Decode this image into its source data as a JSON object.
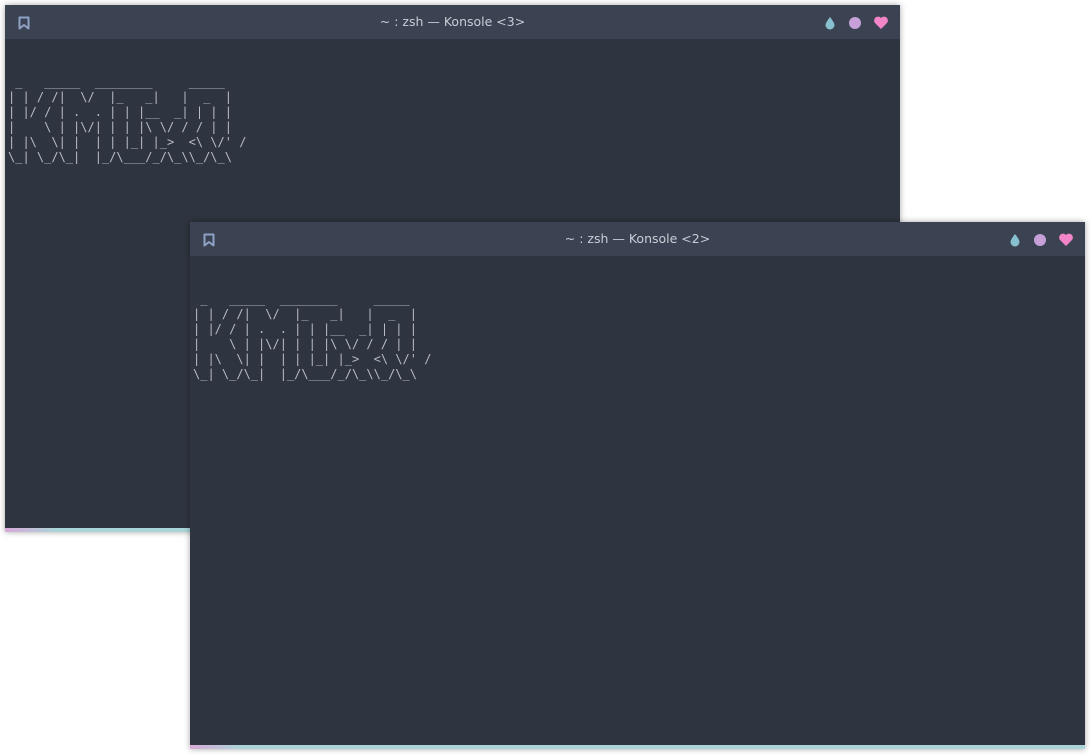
{
  "windows": [
    {
      "title": "~ : zsh — Konsole <3>",
      "terminal_text": " _   _____  ________     _____\n| | / /|  \\/  |_   _|   |  _  |\n| |/ / | .  . | | |__  _| | | |\n|    \\ | |\\/| | | |\\ \\/ / / | |\n| |\\  \\| |  | | |_| |_>  <\\ \\/' /\n\\_| \\_/\\_|  |_/\\___/_/\\_\\\\_/\\_\\"
    },
    {
      "title": "~ : zsh — Konsole <2>",
      "terminal_text": " _   _____  ________     _____\n| | / /|  \\/  |_   _|   |  _  |\n| |/ / | .  . | | |__  _| | | |\n|    \\ | |\\/| | | |\\ \\/ / / | |\n| |\\  \\| |  | | |_| |_>  <\\ \\/' /\n\\_| \\_/\\_|  |_/\\___/_/\\_\\\\_/\\_\\"
    }
  ],
  "icons": {
    "bookmark": "bookmark-icon",
    "minimize": "droplet-icon",
    "maximize": "circle-icon",
    "close": "heart-icon"
  },
  "colors": {
    "titlebar": "#3b4252",
    "terminal_bg": "#2e3440",
    "text": "#b7bcc5",
    "bookmark": "#8fa1c7",
    "minimize": "#88c0d0",
    "maximize": "#c7a0d8",
    "close": "#f285c8"
  }
}
